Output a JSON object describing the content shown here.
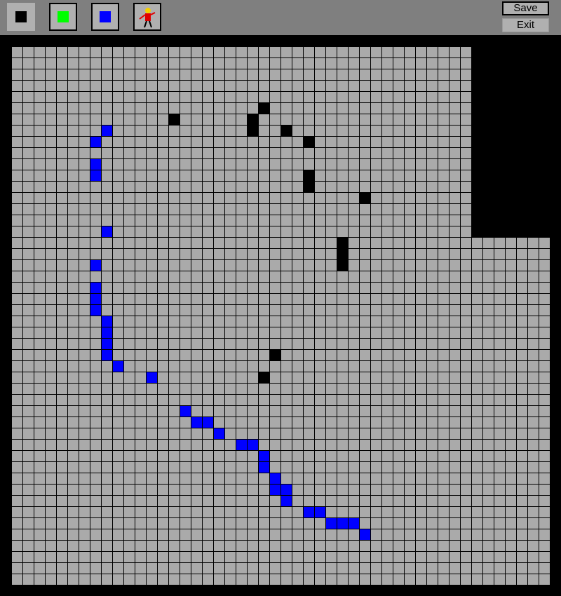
{
  "toolbar": {
    "tools": [
      {
        "name": "black-tile-tool",
        "icon": "black-square",
        "color": "#000000",
        "selected": true
      },
      {
        "name": "green-tile-tool",
        "icon": "green-square",
        "color": "#00ff00",
        "selected": false
      },
      {
        "name": "blue-tile-tool",
        "icon": "blue-square",
        "color": "#0000ff",
        "selected": false
      },
      {
        "name": "character-tool",
        "icon": "person-sprite",
        "selected": false
      }
    ],
    "save_label": "Save",
    "exit_label": "Exit"
  },
  "board": {
    "columns": 48,
    "rows": 48,
    "colors": {
      "floor": "#aaaaaa",
      "wall": "#000000",
      "blue": "#0000ff",
      "grid_line": "#000000"
    },
    "void_region": {
      "from_col": 41,
      "to_col": 47,
      "from_row": 0,
      "to_row": 16
    },
    "black_cells": [
      [
        14,
        6
      ],
      [
        22,
        5
      ],
      [
        21,
        6
      ],
      [
        21,
        7
      ],
      [
        24,
        7
      ],
      [
        26,
        8
      ],
      [
        26,
        11
      ],
      [
        26,
        12
      ],
      [
        31,
        13
      ],
      [
        29,
        17
      ],
      [
        29,
        18
      ],
      [
        29,
        19
      ],
      [
        23,
        27
      ],
      [
        22,
        29
      ]
    ],
    "blue_cells": [
      [
        8,
        7
      ],
      [
        7,
        8
      ],
      [
        7,
        10
      ],
      [
        7,
        11
      ],
      [
        8,
        16
      ],
      [
        7,
        19
      ],
      [
        7,
        21
      ],
      [
        7,
        22
      ],
      [
        7,
        23
      ],
      [
        8,
        24
      ],
      [
        8,
        25
      ],
      [
        8,
        26
      ],
      [
        8,
        27
      ],
      [
        9,
        28
      ],
      [
        12,
        29
      ],
      [
        15,
        32
      ],
      [
        16,
        33
      ],
      [
        17,
        33
      ],
      [
        18,
        34
      ],
      [
        20,
        35
      ],
      [
        21,
        35
      ],
      [
        22,
        36
      ],
      [
        22,
        37
      ],
      [
        23,
        38
      ],
      [
        23,
        39
      ],
      [
        24,
        39
      ],
      [
        24,
        40
      ],
      [
        26,
        41
      ],
      [
        27,
        41
      ],
      [
        28,
        42
      ],
      [
        29,
        42
      ],
      [
        30,
        42
      ],
      [
        31,
        43
      ]
    ]
  }
}
